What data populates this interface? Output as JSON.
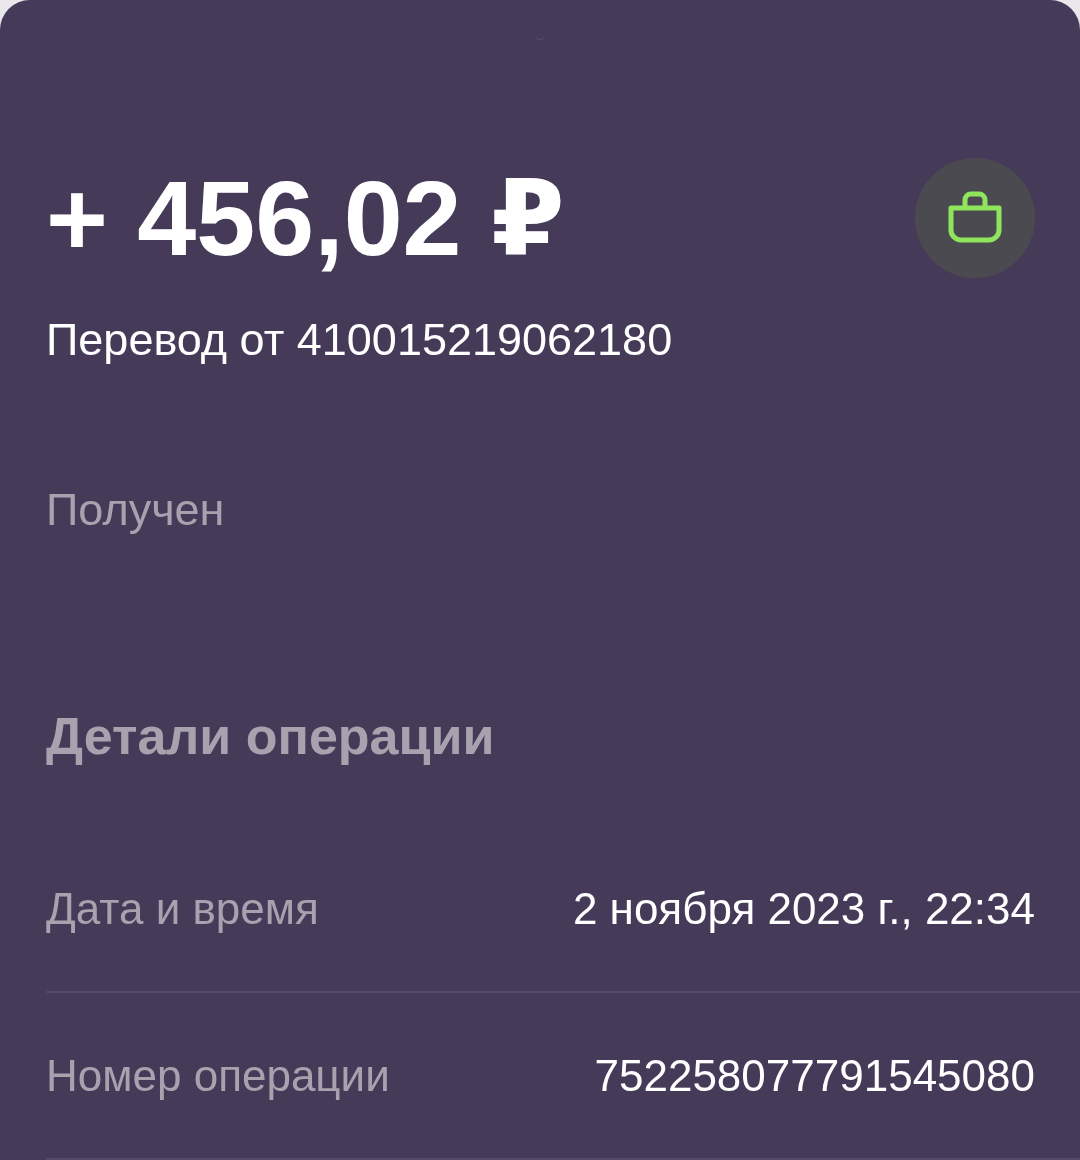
{
  "amount": "+ 456,02 ₽",
  "description": "Перевод от 410015219062180",
  "status": "Получен",
  "section_title": "Детали операции",
  "details": [
    {
      "label": "Дата и время",
      "value": "2 ноября 2023 г., 22:34"
    },
    {
      "label": "Номер операции",
      "value": "752258077791545080"
    }
  ]
}
